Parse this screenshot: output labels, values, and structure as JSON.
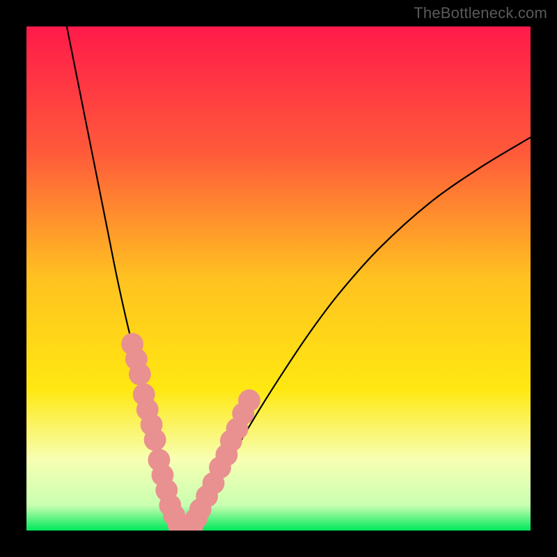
{
  "watermark": "TheBottleneck.com",
  "chart_data": {
    "type": "line",
    "title": "",
    "xlabel": "",
    "ylabel": "",
    "xlim": [
      0,
      100
    ],
    "ylim": [
      0,
      100
    ],
    "legend": false,
    "grid": false,
    "background_gradient": {
      "stops": [
        {
          "offset": 0.0,
          "color": "#ff1a4a"
        },
        {
          "offset": 0.25,
          "color": "#ff5a3a"
        },
        {
          "offset": 0.5,
          "color": "#ffc220"
        },
        {
          "offset": 0.72,
          "color": "#ffe812"
        },
        {
          "offset": 0.86,
          "color": "#f7ffb3"
        },
        {
          "offset": 0.95,
          "color": "#c9ffb0"
        },
        {
          "offset": 1.0,
          "color": "#00e85a"
        }
      ]
    },
    "series": [
      {
        "name": "bottleneck-curve",
        "x": [
          8.0,
          10,
          12,
          14,
          16,
          18,
          20,
          21,
          22,
          23,
          24,
          25,
          26,
          27,
          28,
          29,
          30,
          31,
          32,
          33,
          34.5,
          36,
          38,
          41,
          45,
          50,
          56,
          62,
          70,
          80,
          90,
          100
        ],
        "y": [
          100,
          90,
          80,
          70,
          60,
          50,
          41,
          37,
          33,
          29,
          25,
          21,
          17,
          13,
          9,
          5,
          2,
          0.4,
          0.2,
          0.9,
          2.5,
          5,
          9,
          15,
          22,
          30,
          39,
          47,
          56,
          65,
          72,
          78
        ]
      }
    ],
    "markers": {
      "name": "highlight-dots",
      "color": "#e99090",
      "radius": 2.2,
      "points": [
        {
          "x": 21.0,
          "y": 37
        },
        {
          "x": 21.8,
          "y": 34
        },
        {
          "x": 22.5,
          "y": 31
        },
        {
          "x": 23.3,
          "y": 27
        },
        {
          "x": 24.0,
          "y": 24
        },
        {
          "x": 24.8,
          "y": 21
        },
        {
          "x": 25.5,
          "y": 18
        },
        {
          "x": 26.3,
          "y": 14
        },
        {
          "x": 27.0,
          "y": 11
        },
        {
          "x": 27.8,
          "y": 8
        },
        {
          "x": 28.5,
          "y": 5
        },
        {
          "x": 29.3,
          "y": 3
        },
        {
          "x": 30.2,
          "y": 1.2
        },
        {
          "x": 31.1,
          "y": 0.3
        },
        {
          "x": 32.0,
          "y": 0.3
        },
        {
          "x": 32.9,
          "y": 1.0
        },
        {
          "x": 33.7,
          "y": 2.4
        },
        {
          "x": 34.5,
          "y": 4.2
        },
        {
          "x": 35.8,
          "y": 6.8
        },
        {
          "x": 37.1,
          "y": 9.4
        },
        {
          "x": 38.4,
          "y": 12.5
        },
        {
          "x": 39.7,
          "y": 15.0
        },
        {
          "x": 40.6,
          "y": 17.8
        },
        {
          "x": 41.8,
          "y": 20.2
        },
        {
          "x": 43.0,
          "y": 23.2
        },
        {
          "x": 44.2,
          "y": 25.8
        }
      ]
    }
  }
}
